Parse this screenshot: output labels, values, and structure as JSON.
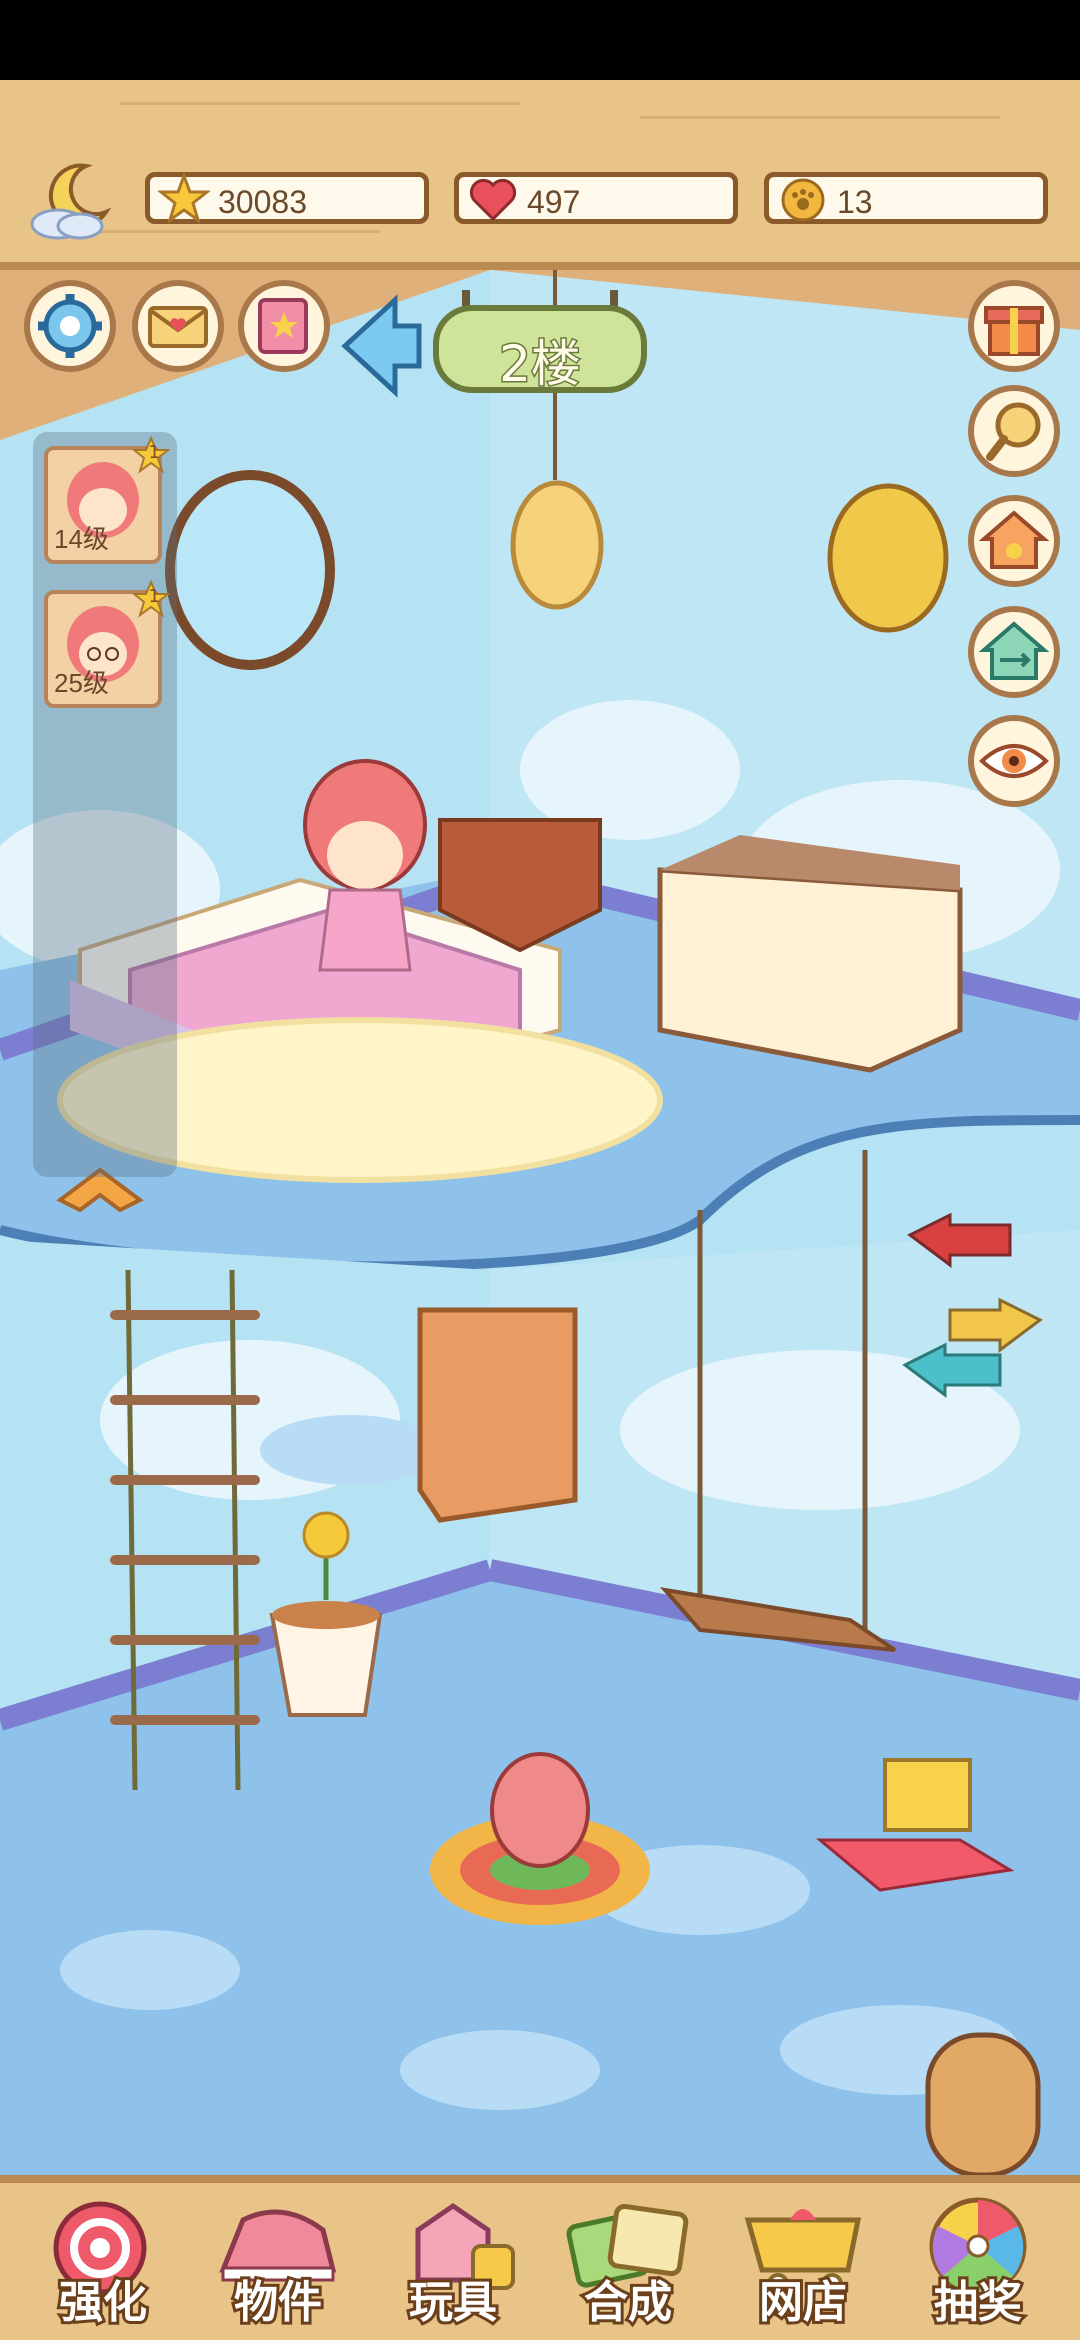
{
  "resources": {
    "stars": "30083",
    "hearts": "497",
    "paws": "13"
  },
  "floor": {
    "label": "2楼"
  },
  "characters": [
    {
      "level": "14级",
      "badge": "1"
    },
    {
      "level": "25级",
      "badge": "1"
    }
  ],
  "bottom_nav": [
    {
      "label": "强化",
      "icon": "lollipop-icon"
    },
    {
      "label": "物件",
      "icon": "piano-icon"
    },
    {
      "label": "玩具",
      "icon": "toys-icon"
    },
    {
      "label": "合成",
      "icon": "cards-icon"
    },
    {
      "label": "网店",
      "icon": "shop-cart-icon"
    },
    {
      "label": "抽奖",
      "icon": "lottery-wheel-icon"
    }
  ],
  "colors": {
    "wood": "#e8c489",
    "wall": "#b6e3f3",
    "floor": "#8ec2ea",
    "trim": "#7c7fd1"
  }
}
